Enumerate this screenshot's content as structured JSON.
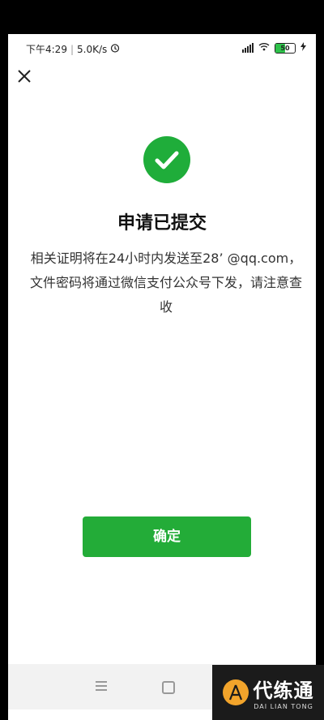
{
  "status_bar": {
    "time": "下午4:29",
    "network_speed": "5.0K/s",
    "alarm_icon": "alarm-clock-icon",
    "network_type": "4G",
    "wifi_icon": "wifi-icon",
    "battery_level": "50",
    "charging_icon": "lightning-icon"
  },
  "header": {
    "close_icon": "close-icon"
  },
  "result": {
    "icon": "check-circle-icon",
    "icon_color": "#1fad3a",
    "title": "申请已提交",
    "description": "相关证明将在24小时内发送至28’ @qq.com，文件密码将通过微信支付公众号下发，请注意查收"
  },
  "actions": {
    "confirm_label": "确定",
    "confirm_color": "#23ac38"
  },
  "nav_bar": {
    "menu_icon": "menu-icon",
    "home_icon": "home-square-icon"
  },
  "watermark": {
    "logo_icon": "compass-logo-icon",
    "text": "代练通",
    "subtext": "DAI LIAN TONG"
  }
}
